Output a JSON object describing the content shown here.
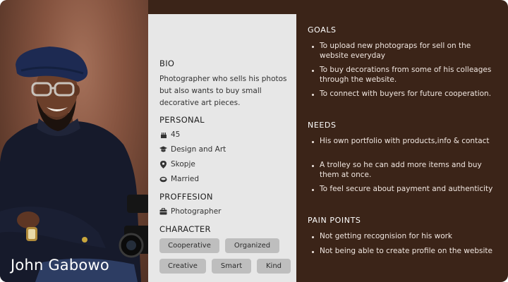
{
  "persona": {
    "name": "John Gabowo"
  },
  "bio": {
    "title": "BIO",
    "text": "Photographer who sells his photos but also wants to buy small decorative art pieces."
  },
  "personal": {
    "title": "PERSONAL",
    "items": [
      {
        "icon": "cake-icon",
        "label": "45"
      },
      {
        "icon": "graduation-cap-icon",
        "label": "Design and Art"
      },
      {
        "icon": "location-pin-icon",
        "label": "Skopje"
      },
      {
        "icon": "rings-icon",
        "label": "Married"
      }
    ]
  },
  "profession": {
    "title": "PROFFESION",
    "items": [
      {
        "icon": "briefcase-icon",
        "label": "Photographer"
      }
    ]
  },
  "character": {
    "title": "CHARACTER",
    "traits": [
      "Cooperative",
      "Organized",
      "Creative",
      "Smart",
      "Kind"
    ]
  },
  "goals": {
    "title": "GOALS",
    "items": [
      "To upload new photograps for sell on the website everyday",
      "To buy decorations from some of his colleages through the website.",
      "To connect with buyers for future cooperation."
    ]
  },
  "needs": {
    "title": "NEEDS",
    "items": [
      "His own portfolio with products,info & contact",
      "A trolley so he can add more items and buy them at once.",
      "To feel secure about payment and authenticity"
    ]
  },
  "pain_points": {
    "title": "PAIN POINTS",
    "items": [
      "Not getting recognision for his work",
      "Not being able to create profile on the website"
    ]
  },
  "colors": {
    "right_panel": "#3b2418",
    "middle_panel": "#e7e7e7",
    "chip": "#bebebe"
  }
}
